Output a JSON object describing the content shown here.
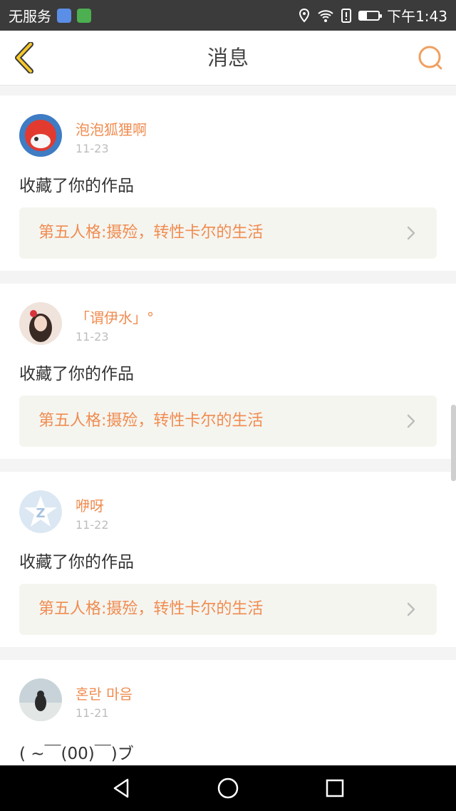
{
  "status_bar": {
    "carrier": "无服务",
    "time": "下午1:43",
    "battery_level": 0.4
  },
  "header": {
    "title": "消息",
    "back_icon": "chevron-left-icon",
    "search_icon": "search-icon"
  },
  "messages": [
    {
      "user": "泡泡狐狸啊",
      "date": "11-23",
      "action": "收藏了你的作品",
      "work_title": "第五人格:摄殓，转性卡尔的生活"
    },
    {
      "user": "「谓伊水」°",
      "date": "11-23",
      "action": "收藏了你的作品",
      "work_title": "第五人格:摄殓，转性卡尔的生活"
    },
    {
      "user": "咿呀",
      "date": "11-22",
      "action": "收藏了你的作品",
      "work_title": "第五人格:摄殓，转性卡尔的生活"
    },
    {
      "user": "혼란 마음",
      "date": "11-21",
      "action": "( ~￣(00)￣)ブ"
    }
  ],
  "colors": {
    "accent": "#f08c50",
    "header_bg": "#ffffff",
    "status_bar_bg": "#3b3b3b",
    "nav_bar_bg": "#000000"
  }
}
